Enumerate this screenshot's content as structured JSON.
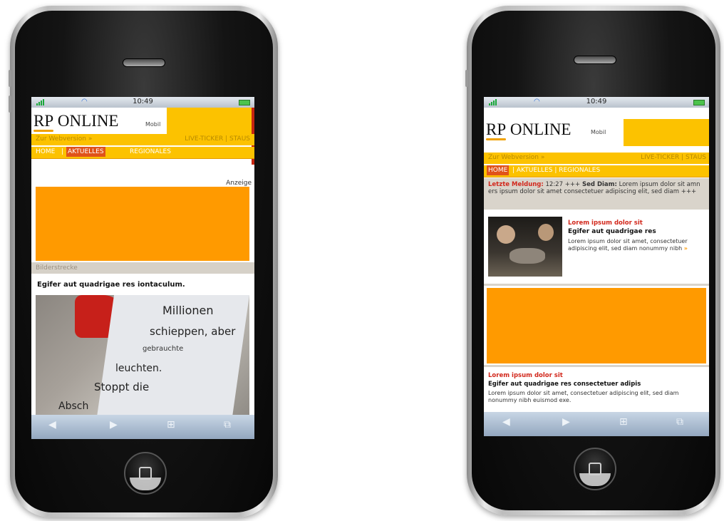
{
  "status": {
    "time": "10:49",
    "wifi_icon": "wifi-icon",
    "battery_icon": "battery-icon"
  },
  "brand": {
    "logo_rp": "RP",
    "logo_online": "ONLINE",
    "mobil": "Mobil"
  },
  "phone_left": {
    "bar_left": "Zur Webversion »",
    "bar_right": "LIVE-TICKER | STAUS",
    "nav": {
      "home": "HOME",
      "sep": "|",
      "aktuelles": "AKTUELLES",
      "regionales": "REGIONALES"
    },
    "anzeige": "Anzeige",
    "section": "Bilderstrecke",
    "headline": "Egifer aut quadrigae res iontaculum.",
    "photo_words": [
      "Millionen",
      "schieppen, aber",
      "gebrauchte",
      "leuchten.",
      "Stoppt die",
      "Absch"
    ]
  },
  "phone_right": {
    "bar_left": "Zur Webversion »",
    "bar_right": "LIVE-TICKER | STAUS",
    "nav": {
      "home": "HOME",
      "rest": "| AKTUELLES | REGIONALES"
    },
    "ticker_label": "Letzte Meldung:",
    "ticker_time": " 12:27 +++",
    "ticker_bold": " Sed Diam:",
    "ticker_text": " Lorem ipsum dolor sit amn ers ipsum dolor sit amet consectetuer adipiscing elit, sed diam +++",
    "story1": {
      "kicker": "Lorem ipsum dolor sit",
      "title": "Egifer aut quadrigae res",
      "text": "Lorem ipsum dolor sit amet, consectetuer adipiscing elit, sed diam nonummy nibh",
      "more": "»"
    },
    "story2": {
      "kicker": "Lorem ipsum dolor sit",
      "title": "Egifer aut quadrigae res consectetuer adipis",
      "text": "Lorem ipsum dolor sit amet, consectetuer adipiscing elit, sed diam nonummy nibh euismod exe."
    }
  },
  "toolbar": {
    "back": "◀",
    "forward": "▶",
    "bookmarks": "⊞",
    "pages": "⧉"
  },
  "colors": {
    "yellow": "#fcc200",
    "orange": "#ff9a00",
    "nav_active": "#e0531a",
    "red_text": "#d2281c"
  }
}
